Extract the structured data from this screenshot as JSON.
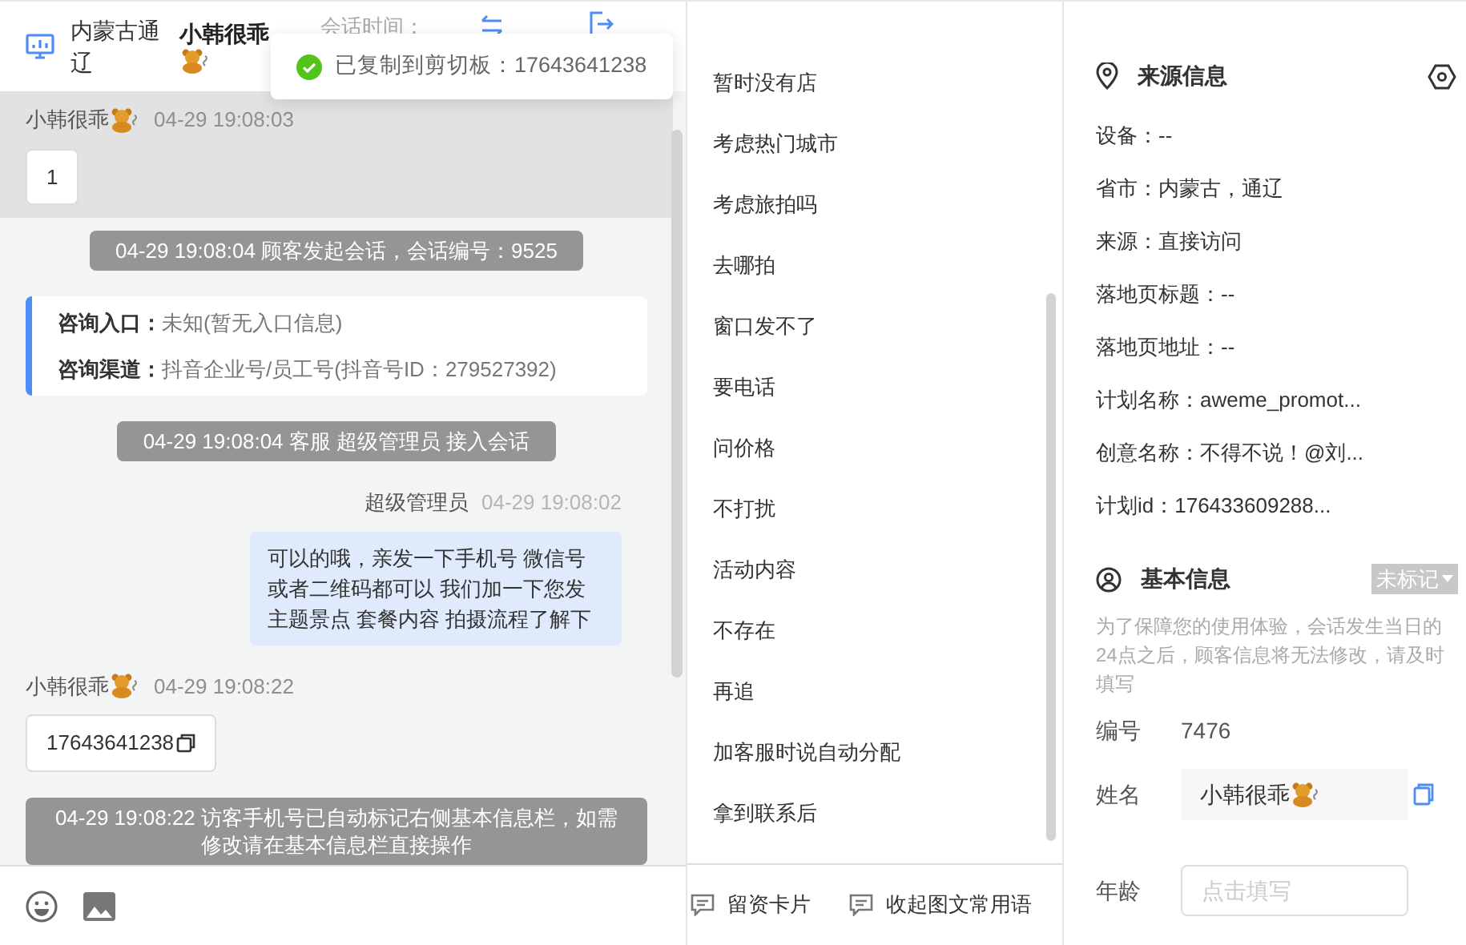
{
  "header": {
    "location": "内蒙古通辽",
    "customer_name": "小韩很乖",
    "session_time_label": "会话时间："
  },
  "toast": {
    "text": "已复制到剪切板：17643641238"
  },
  "messages": [
    {
      "kind": "customer",
      "highlighted": true,
      "name": "小韩很乖",
      "time": "04-29 19:08:03",
      "text": "1",
      "copyable": false
    },
    {
      "kind": "notice",
      "text": "04-29 19:08:04 顾客发起会话，会话编号：9525"
    },
    {
      "kind": "info",
      "rows": [
        {
          "label": "咨询入口：",
          "value": "未知(暂无入口信息)"
        },
        {
          "label": "咨询渠道：",
          "value": "抖音企业号/员工号(抖音号ID：279527392)"
        }
      ]
    },
    {
      "kind": "notice",
      "text": "04-29 19:08:04 客服 超级管理员 接入会话"
    },
    {
      "kind": "agent",
      "name": "超级管理员",
      "time": "04-29 19:08:02",
      "text": "可以的哦，亲发一下手机号 微信号或者二维码都可以 我们加一下您发主题景点 套餐内容 拍摄流程了解下"
    },
    {
      "kind": "customer",
      "highlighted": false,
      "name": "小韩很乖",
      "time": "04-29 19:08:22",
      "text": "17643641238",
      "copyable": true
    },
    {
      "kind": "notice",
      "text": "04-29 19:08:22 访客手机号已自动标记右侧基本信息栏，如需修改请在基本信息栏直接操作"
    }
  ],
  "phrases": {
    "items": [
      "暂时没有店",
      "考虑热门城市",
      "考虑旅拍吗",
      "去哪拍",
      "窗口发不了",
      "要电话",
      "问价格",
      "不打扰",
      "活动内容",
      "不存在",
      "再追",
      "加客服时说自动分配",
      "拿到联系后"
    ],
    "buttons": [
      "留资卡片",
      "收起图文常用语"
    ]
  },
  "source_info": {
    "title": "来源信息",
    "rows": [
      "设备：--",
      "省市：内蒙古，通辽",
      "来源：直接访问",
      "落地页标题：--",
      "落地页地址：--",
      "计划名称：aweme_promot...",
      "创意名称：不得不说！@刘...",
      "计划id：176433609288..."
    ]
  },
  "basic_info": {
    "title": "基本信息",
    "tag": "未标记",
    "note": "为了保障您的使用体验，会话发生当日的24点之后，顾客信息将无法修改，请及时填写",
    "fields": [
      {
        "kind": "text",
        "label": "编号",
        "value": "7476"
      },
      {
        "kind": "filled",
        "label": "姓名",
        "value": "小韩很乖"
      },
      {
        "kind": "input",
        "label": "年龄",
        "placeholder": "点击填写"
      }
    ]
  }
}
